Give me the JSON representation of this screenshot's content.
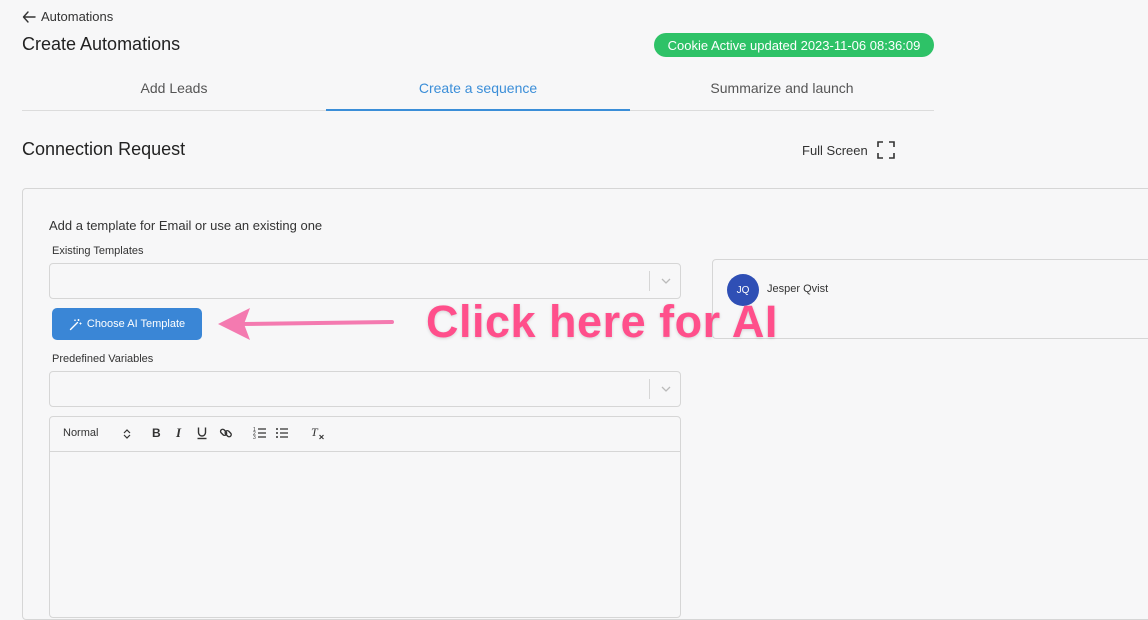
{
  "header": {
    "back_label": "Automations",
    "title": "Create Automations",
    "cookie_status": "Cookie Active updated 2023-11-06 08:36:09"
  },
  "tabs": [
    {
      "label": "Add Leads",
      "active": false
    },
    {
      "label": "Create a sequence",
      "active": true
    },
    {
      "label": "Summarize and launch",
      "active": false
    }
  ],
  "section": {
    "title": "Connection Request",
    "fullscreen_label": "Full Screen"
  },
  "form": {
    "help_text": "Add a template for Email or use an existing one",
    "existing_templates_label": "Existing Templates",
    "ai_button_label": "Choose AI Template",
    "predefined_variables_label": "Predefined Variables",
    "editor": {
      "format_value": "Normal",
      "tools": [
        "bold-icon",
        "italic-icon",
        "underline-icon",
        "link-icon",
        "ordered-list-icon",
        "bullet-list-icon",
        "clear-format-icon"
      ]
    }
  },
  "preview": {
    "avatar_initials": "JQ",
    "user_name": "Jesper Qvist"
  },
  "annotation": {
    "callout_text": "Click here for AI"
  },
  "colors": {
    "accent": "#3b8ed8",
    "button": "#3a86d6",
    "badge": "#2ec267",
    "callout": "#ff4f8b",
    "avatar": "#2f4fb5"
  }
}
